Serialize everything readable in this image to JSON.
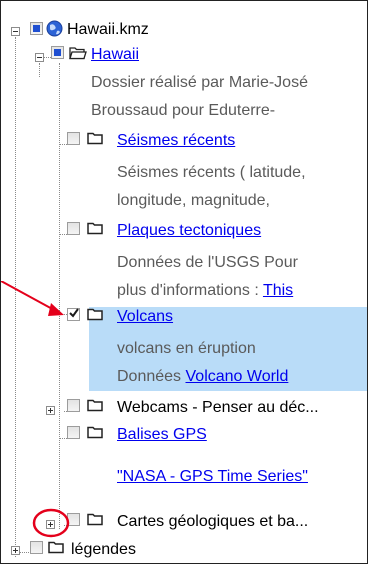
{
  "tree": {
    "root": {
      "label": "Hawaii.kmz",
      "icon": "earth-globe-icon",
      "expanded": true
    },
    "hawaii": {
      "label": "Hawaii",
      "description_lines": [
        "Dossier réalisé par Marie-José",
        "Broussaud pour Eduterre-"
      ],
      "expanded": true
    },
    "items": [
      {
        "label": "Séismes récents",
        "description_lines": [
          "Séismes récents ( latitude,",
          "longitude, magnitude,"
        ]
      },
      {
        "label": "Plaques tectoniques",
        "description_lines": [
          "Données de l'USGS Pour",
          "plus d'informations : "
        ],
        "inline_link": "This"
      },
      {
        "label": "Volcans",
        "checked": true,
        "selected": true,
        "description_line1": "volcans en éruption",
        "description_prefix": "Données ",
        "inline_link": "Volcano World"
      },
      {
        "label": "Webcams - Penser au déc...",
        "collapsed": true
      },
      {
        "label": "Balises GPS",
        "extra_link": "\"NASA - GPS Time Series\""
      },
      {
        "label": "Cartes géologiques et ba...",
        "collapsed": true
      }
    ],
    "legendes": {
      "label": "légendes",
      "collapsed": true
    }
  },
  "annotations": {
    "arrow_color": "#e4001b",
    "circle_color": "#e4001b"
  },
  "colors": {
    "selection": "#b9dcf8",
    "link": "#0000ee",
    "description": "#5a5a5a",
    "check_blue": "#1f4fd1"
  }
}
